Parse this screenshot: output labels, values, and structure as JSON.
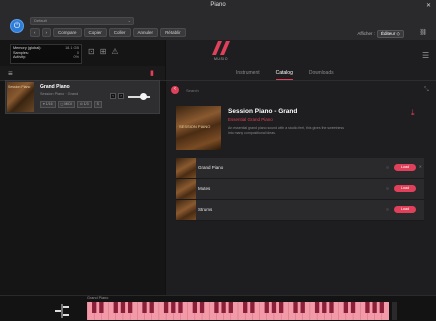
{
  "app": {
    "title": "Piano"
  },
  "toolbar": {
    "preset_placeholder": "Default",
    "nav_back": "‹",
    "nav_forward": "›",
    "compare_label": "Compare",
    "copy_label": "Copier",
    "paste_label": "Coller",
    "undo_label": "Annuler",
    "redo_label": "Rétablir",
    "view_label": "Afficher :",
    "view_value": "Éditeur ◇",
    "link_icon": "link-icon"
  },
  "memory": {
    "rows": [
      {
        "label": "Memory (global):",
        "value": "18.1 GB"
      },
      {
        "label": "Samples:",
        "value": "0"
      },
      {
        "label": "Activity:",
        "value": "0%"
      }
    ]
  },
  "rack": {
    "instrument_name": "Grand Piano",
    "instrument_sub": "Session Piano · Grand",
    "thumb_label": "Session Piano",
    "buttons": [
      "▾ 1/16",
      "◻ MIDI",
      "⊙ 1/3",
      "S"
    ],
    "volume": 0.72
  },
  "brand": {
    "name": "MUSIO"
  },
  "tabs": [
    {
      "label": "Instrument",
      "active": false
    },
    {
      "label": "Catalog",
      "active": true
    },
    {
      "label": "Downloads",
      "active": false
    }
  ],
  "catalog": {
    "breadcrumb": "Search",
    "hero": {
      "image_label": "SESSION PIANO",
      "title": "Session Piano - Grand",
      "subtitle": "Essential Grand Piano",
      "description": "An essential grand piano sound with a studio feel, this gives the sweetness into many compositional ideas."
    },
    "items": [
      {
        "name": "Grand Piano",
        "action": "Load"
      },
      {
        "name": "Mutes",
        "action": "Load"
      },
      {
        "name": "Strums",
        "action": "Load"
      }
    ]
  },
  "keyboard": {
    "label": "Grand Piano"
  },
  "colors": {
    "accent": "#e0405a",
    "power": "#2e7dd8"
  }
}
